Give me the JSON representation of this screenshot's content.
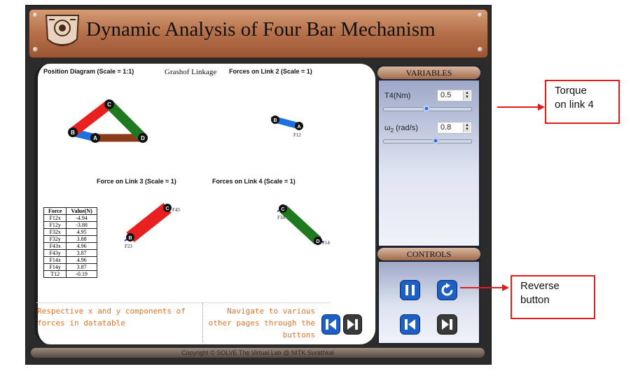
{
  "title": "Dynamic Analysis of Four Bar Mechanism",
  "position_diagram": {
    "label": "Position Diagram (Scale = 1:1)",
    "linkage_label": "Grashof Linkage",
    "joints": [
      "A",
      "B",
      "C",
      "D"
    ]
  },
  "forces_link2": {
    "label": "Forces on Link 2 (Scale = 1)",
    "force_label": "F12",
    "joints": [
      "B",
      "A"
    ]
  },
  "forces_link3": {
    "label": "Force on Link 3 (Scale = 1)",
    "top_force": "F43",
    "bottom_force": "F23",
    "joints": [
      "C",
      "B"
    ]
  },
  "forces_link4": {
    "label": "Forces on Link 4 (Scale = 1)",
    "top_force": "F34",
    "bottom_force": "F14",
    "joints": [
      "C",
      "D"
    ]
  },
  "force_table": {
    "headers": [
      "Force",
      "Value(N)"
    ],
    "rows": [
      [
        "F12x",
        "-4.94"
      ],
      [
        "F12y",
        "-3.88"
      ],
      [
        "F32x",
        "4.95"
      ],
      [
        "F32y",
        "3.88"
      ],
      [
        "F43x",
        "4.96"
      ],
      [
        "F43y",
        "3.87"
      ],
      [
        "F14x",
        "4.96"
      ],
      [
        "F14y",
        "3.87"
      ],
      [
        "T12",
        "-0.19"
      ]
    ]
  },
  "notes": {
    "table_note": [
      "Respective x and y components of",
      "forces in datatable"
    ],
    "nav_note": [
      "Navigate to various",
      "other pages through the",
      "buttons"
    ]
  },
  "variables": {
    "header": "VARIABLES",
    "t4": {
      "label": "T4(Nm)",
      "value": "0.5",
      "slider_fraction": 0.49
    },
    "w2": {
      "label": "ω",
      "sub": "2",
      "unit": " (rad/s)",
      "value": "0.8",
      "slider_fraction": 0.59
    }
  },
  "controls": {
    "header": "CONTROLS"
  },
  "footer": "Copyright © SOLVE The Virtual Lab @ NITK Surathkal",
  "callouts": {
    "torque": [
      "Torque",
      "on link 4"
    ],
    "reverse": [
      "Reverse",
      "button"
    ]
  },
  "colors": {
    "link_red": "#e82020",
    "link_green": "#1f7a1f",
    "link_brown": "#8b3a1a",
    "link_blue": "#1e6fe0",
    "note_orange": "#e0742a",
    "callout_red": "#e31b1b"
  }
}
